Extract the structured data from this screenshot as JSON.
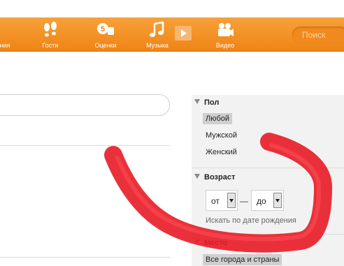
{
  "topnav": {
    "items": [
      {
        "label": "ния",
        "icon": "cut-off-icon"
      },
      {
        "label": "Гости",
        "icon": "footprints-icon"
      },
      {
        "label": "Оценки",
        "icon": "rating-hand-5-icon"
      },
      {
        "label": "Музыка",
        "icon": "music-note-icon"
      },
      {
        "label": "Видео",
        "icon": "video-camera-icon"
      }
    ],
    "play_icon": "play-button-icon",
    "search_placeholder": "Поиск"
  },
  "filters": {
    "gender": {
      "title": "Пол",
      "options": [
        "Любой",
        "Мужской",
        "Женский"
      ],
      "selected": "Любой"
    },
    "age": {
      "title": "Возраст",
      "from_value": "от",
      "separator": "—",
      "to_value": "до",
      "hint": "Искать по дате рождения"
    },
    "place": {
      "title": "Место",
      "selected_value": "Все города и страны"
    }
  },
  "colors": {
    "topbar": "#f0891a",
    "scribble": "#e8202a",
    "panel": "#f2f2f2"
  }
}
